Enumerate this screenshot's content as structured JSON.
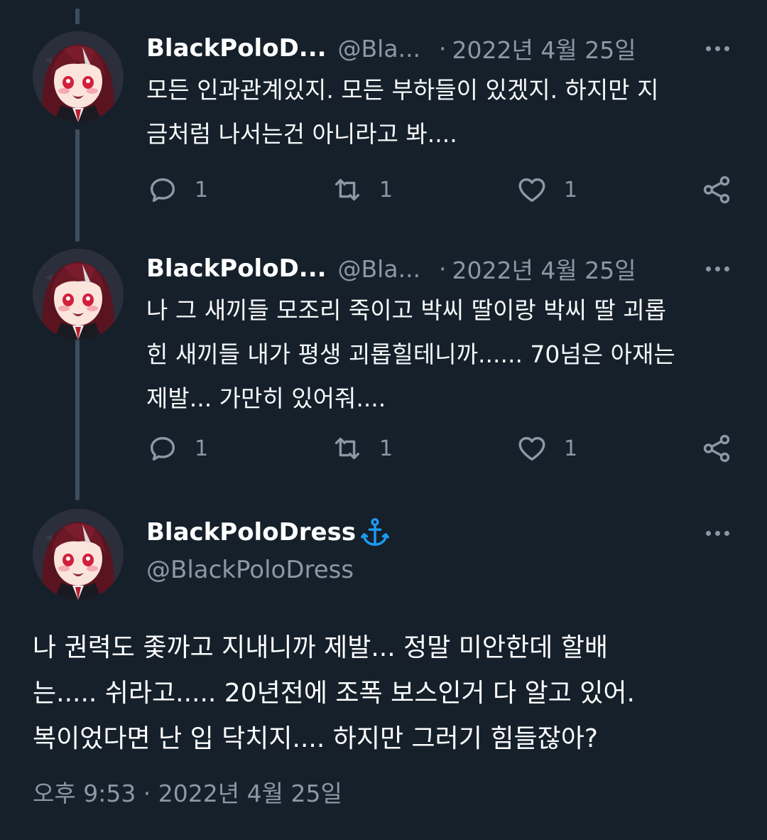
{
  "tweets": [
    {
      "name": "BlackPoloD...",
      "handle": "@Bla...",
      "separator": "·",
      "date": "2022년 4월 25일",
      "text": "모든 인과관계있지. 모든 부하들이 있겠지. 하지만 지\n금처럼 나서는건 아니라고 봐....",
      "replies": "1",
      "retweets": "1",
      "likes": "1"
    },
    {
      "name": "BlackPoloD...",
      "handle": "@Bla...",
      "separator": "·",
      "date": "2022년 4월 25일",
      "text": "나 그 새끼들 모조리 죽이고 박씨 딸이랑 박씨 딸 괴롭\n힌 새끼들 내가 평생 괴롭힐테니까...... 70넘은 아재는\n제발... 가만히 있어줘....",
      "replies": "1",
      "retweets": "1",
      "likes": "1"
    }
  ],
  "main_tweet": {
    "name": "BlackPoloDress",
    "badge_icon": "anchor-icon",
    "handle": "@BlackPoloDress",
    "text": "나 권력도 좇까고 지내니까 제발... 정말 미안한데 할배\n는..... 쉬라고..... 20년전에 조폭 보스인거 다 알고 있어.\n복이었다면 난 입 닥치지.... 하지만 그러기 힘들잖아?",
    "timestamp": "오후 9:53 · 2022년 4월 25일"
  },
  "colors": {
    "background": "#15202b",
    "muted": "#8b98a5",
    "thread_line": "#3d4d5b",
    "anchor": "#1d9bf0"
  }
}
